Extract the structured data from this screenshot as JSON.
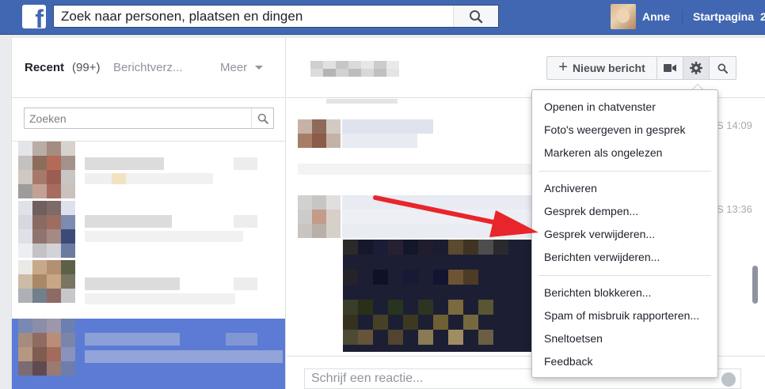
{
  "topbar": {
    "logo": "f",
    "search_placeholder": "Zoek naar personen, plaatsen en dingen",
    "user_name": "Anne",
    "home_label": "Startpagina",
    "extra_label": "2"
  },
  "left": {
    "tab_recent": "Recent",
    "tab_count": "(99+)",
    "tab_requests": "Berichtverz...",
    "tab_more": "Meer",
    "search_placeholder": "Zoeken"
  },
  "conversation": {
    "new_message_label": "Nieuw bericht",
    "times": [
      "S 14:09",
      "S 13:36"
    ],
    "composer_placeholder": "Schrijf een reactie..."
  },
  "menu": {
    "group1": [
      "Openen in chatvenster",
      "Foto's weergeven in gesprek",
      "Markeren als ongelezen"
    ],
    "group2": [
      "Archiveren",
      "Gesprek dempen...",
      "Gesprek verwijderen...",
      "Berichten verwijderen..."
    ],
    "group3": [
      "Berichten blokkeren...",
      "Spam of misbruik rapporteren...",
      "Sneltoetsen",
      "Feedback"
    ]
  },
  "colors": {
    "brand": "#4267b2",
    "selected_row": "#5b7bd5",
    "annotation_arrow": "#e8252a"
  }
}
